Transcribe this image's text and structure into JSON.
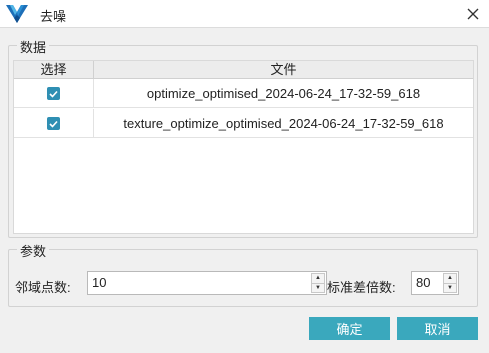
{
  "window": {
    "title": "去噪",
    "logo_icon": "app-logo-icon",
    "close_icon": "close-icon"
  },
  "data_group": {
    "legend": "数据",
    "columns": [
      "选择",
      "文件"
    ],
    "rows": [
      {
        "checked": true,
        "file": "optimize_optimised_2024-06-24_17-32-59_618"
      },
      {
        "checked": true,
        "file": "texture_optimize_optimised_2024-06-24_17-32-59_618"
      }
    ]
  },
  "params_group": {
    "legend": "参数",
    "neighborhood_label": "邻域点数:",
    "neighborhood_value": "10",
    "std_multiplier_label": "标准差倍数:",
    "std_multiplier_value": "80"
  },
  "buttons": {
    "ok": "确定",
    "cancel": "取消"
  },
  "colors": {
    "accent": "#3aa8bd",
    "checkbox": "#2f8fb3"
  }
}
